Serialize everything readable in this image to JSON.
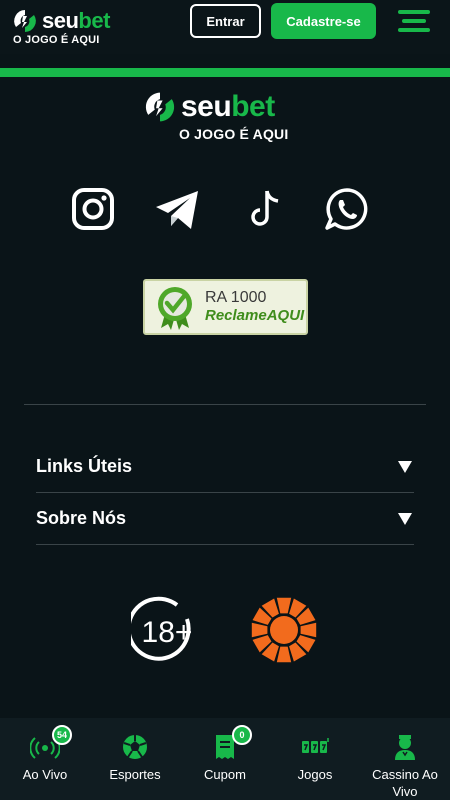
{
  "header": {
    "brand_white": "seu",
    "brand_green": "bet",
    "tagline": "O JOGO É AQUI",
    "login_label": "Entrar",
    "signup_label": "Cadastre-se",
    "menu_icon": "hamburger-menu-icon"
  },
  "footer": {
    "brand_white": "seu",
    "brand_green": "bet",
    "tagline": "O JOGO É AQUI",
    "socials": [
      {
        "name": "instagram-icon"
      },
      {
        "name": "telegram-icon"
      },
      {
        "name": "tiktok-icon"
      },
      {
        "name": "whatsapp-icon"
      }
    ],
    "reclame": {
      "score": "RA 1000",
      "name": "ReclameAQUI"
    },
    "accordions": [
      {
        "label": "Links Úteis"
      },
      {
        "label": "Sobre Nós"
      }
    ],
    "age_badge": "18+"
  },
  "bottom_nav": {
    "items": [
      {
        "label": "Ao Vivo",
        "icon": "live-broadcast-icon",
        "badge": "54"
      },
      {
        "label": "Esportes",
        "icon": "soccer-ball-icon"
      },
      {
        "label": "Cupom",
        "icon": "ticket-coupon-icon",
        "badge": "0"
      },
      {
        "label": "Jogos",
        "icon": "slot-machine-icon"
      },
      {
        "label": "Cassino Ao Vivo",
        "icon": "dealer-icon"
      }
    ]
  },
  "colors": {
    "background": "#0a1418",
    "accent": "#18b84a",
    "nav_bg": "#101c21",
    "sun_orange": "#f26b1d"
  }
}
